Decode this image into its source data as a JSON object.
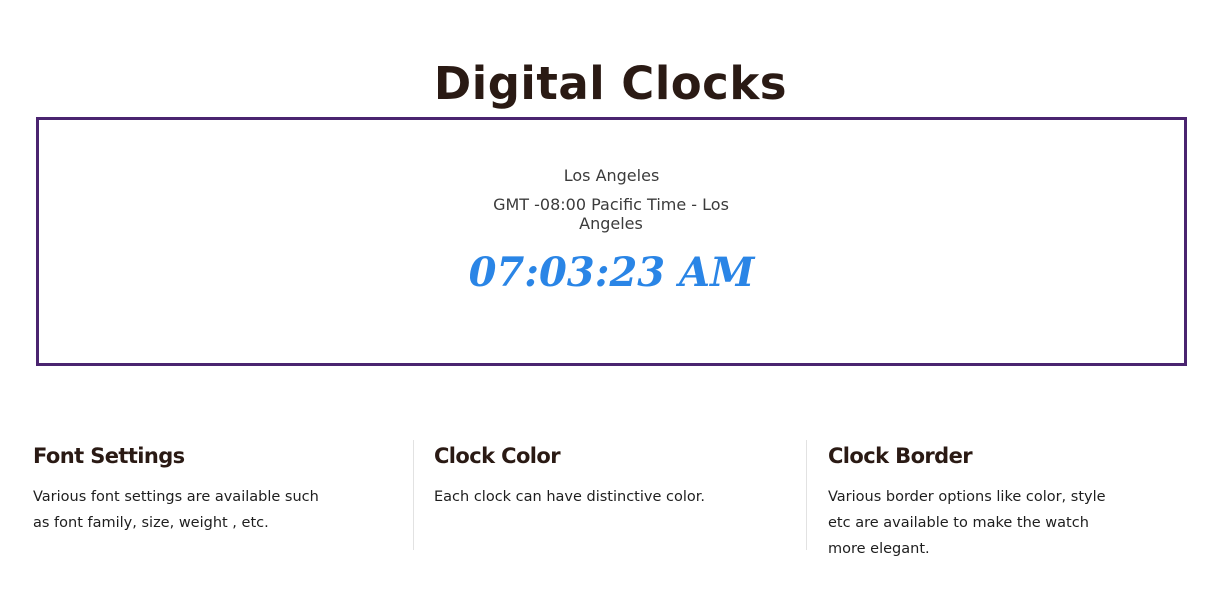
{
  "page": {
    "title": "Digital Clocks"
  },
  "clock": {
    "city": "Los Angeles",
    "zone": "GMT -08:00 Pacific Time - Los Angeles",
    "time": "07:03:23 AM",
    "time_color": "#2a85e6",
    "border_color": "#4a2470"
  },
  "features": [
    {
      "title": "Font Settings",
      "text": "Various font settings are available such as font family, size, weight , etc."
    },
    {
      "title": "Clock Color",
      "text": "Each clock can have distinctive color."
    },
    {
      "title": "Clock Border",
      "text": "Various border options like color, style etc are available to make the watch more elegant."
    }
  ]
}
